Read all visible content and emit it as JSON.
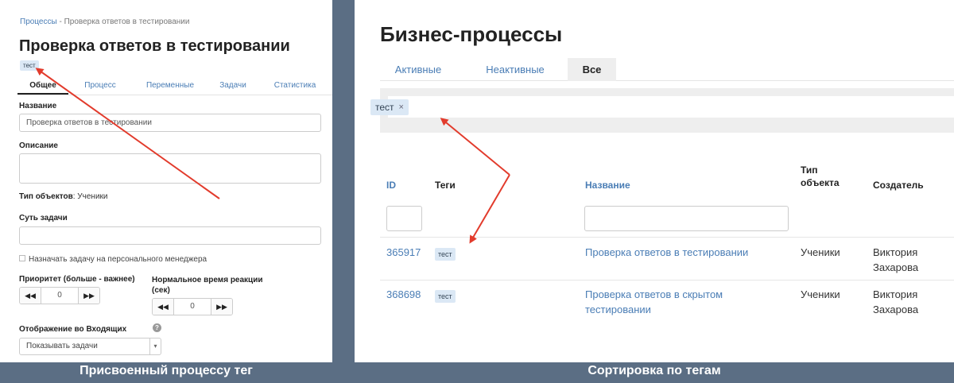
{
  "left": {
    "breadcrumb": {
      "root": "Процессы",
      "separator": "›",
      "current": "Проверка ответов в тестировании"
    },
    "title": "Проверка ответов в тестировании",
    "tag": "тест",
    "tabs": [
      "Общее",
      "Процесс",
      "Переменные",
      "Задачи",
      "Статистика"
    ],
    "fields": {
      "name_label": "Название",
      "name_value": "Проверка ответов в тестировании",
      "description_label": "Описание",
      "object_type_label": "Тип объектов",
      "object_type_value": ": Ученики",
      "task_essence_label": "Суть задачи",
      "assign_manager_label": "Назначать задачу на персонального менеджера",
      "priority_label": "Приоритет (больше - важнее)",
      "priority_value": "0",
      "reaction_time_label": "Нормальное время реакции (сек)",
      "reaction_time_value": "0",
      "inbox_display_label": "Отображение во Входящих",
      "inbox_display_value": "Показывать задачи"
    },
    "caption": "Присвоенный процессу тег"
  },
  "right": {
    "title": "Бизнес-процессы",
    "tabs": [
      {
        "label": "Активные",
        "active": false
      },
      {
        "label": "Неактивные",
        "active": false
      },
      {
        "label": "Все",
        "active": true
      }
    ],
    "filter_tag": "тест",
    "columns": {
      "id": "ID",
      "tags": "Теги",
      "name": "Название",
      "object_type": "Тип объекта",
      "creator": "Создатель"
    },
    "rows": [
      {
        "id": "365917",
        "tag": "тест",
        "name": "Проверка ответов в тестировании",
        "object_type": "Ученики",
        "creator": "Виктория Захарова"
      },
      {
        "id": "368698",
        "tag": "тест",
        "name": "Проверка ответов в скрытом тестировании",
        "object_type": "Ученики",
        "creator": "Виктория Захарова"
      }
    ],
    "caption": "Сортировка по тегам"
  },
  "colors": {
    "background": "#5b6e84",
    "link": "#4a7db5",
    "tag": "#dbe8f5",
    "arrow": "#e23b2c"
  },
  "icons": {
    "rewind": "rewind-icon",
    "fast_forward": "fast-forward-icon",
    "help": "help-icon",
    "remove": "close-icon",
    "dropdown": "chevron-down-icon"
  }
}
